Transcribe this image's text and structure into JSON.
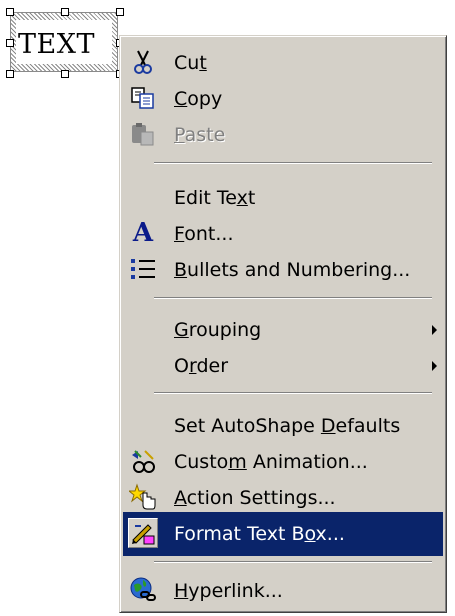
{
  "textbox": {
    "text": "TEXT"
  },
  "menu": {
    "items": [
      {
        "pre": "Cu",
        "u": "t",
        "post": "",
        "icon": "scissors-icon"
      },
      {
        "pre": "",
        "u": "C",
        "post": "opy",
        "icon": "copy-icon"
      },
      {
        "pre": "",
        "u": "P",
        "post": "aste",
        "icon": "paste-icon",
        "disabled": true
      },
      {
        "pre": "Edit Te",
        "u": "x",
        "post": "t"
      },
      {
        "pre": "",
        "u": "F",
        "post": "ont...",
        "icon": "font-icon"
      },
      {
        "pre": "",
        "u": "B",
        "post": "ullets and Numbering...",
        "icon": "bullets-icon"
      },
      {
        "pre": "",
        "u": "G",
        "post": "rouping",
        "submenu": true
      },
      {
        "pre": "O",
        "u": "r",
        "post": "der",
        "submenu": true
      },
      {
        "pre": "Set AutoShape ",
        "u": "D",
        "post": "efaults"
      },
      {
        "pre": "Custo",
        "u": "m",
        "post": " Animation...",
        "icon": "custom-animation-icon"
      },
      {
        "pre": "",
        "u": "A",
        "post": "ction Settings...",
        "icon": "action-settings-icon"
      },
      {
        "pre": "Format Text B",
        "u": "o",
        "post": "x...",
        "icon": "format-textbox-icon",
        "selected": true
      },
      {
        "pre": "",
        "u": "H",
        "post": "yperlink...",
        "icon": "hyperlink-icon"
      }
    ]
  }
}
